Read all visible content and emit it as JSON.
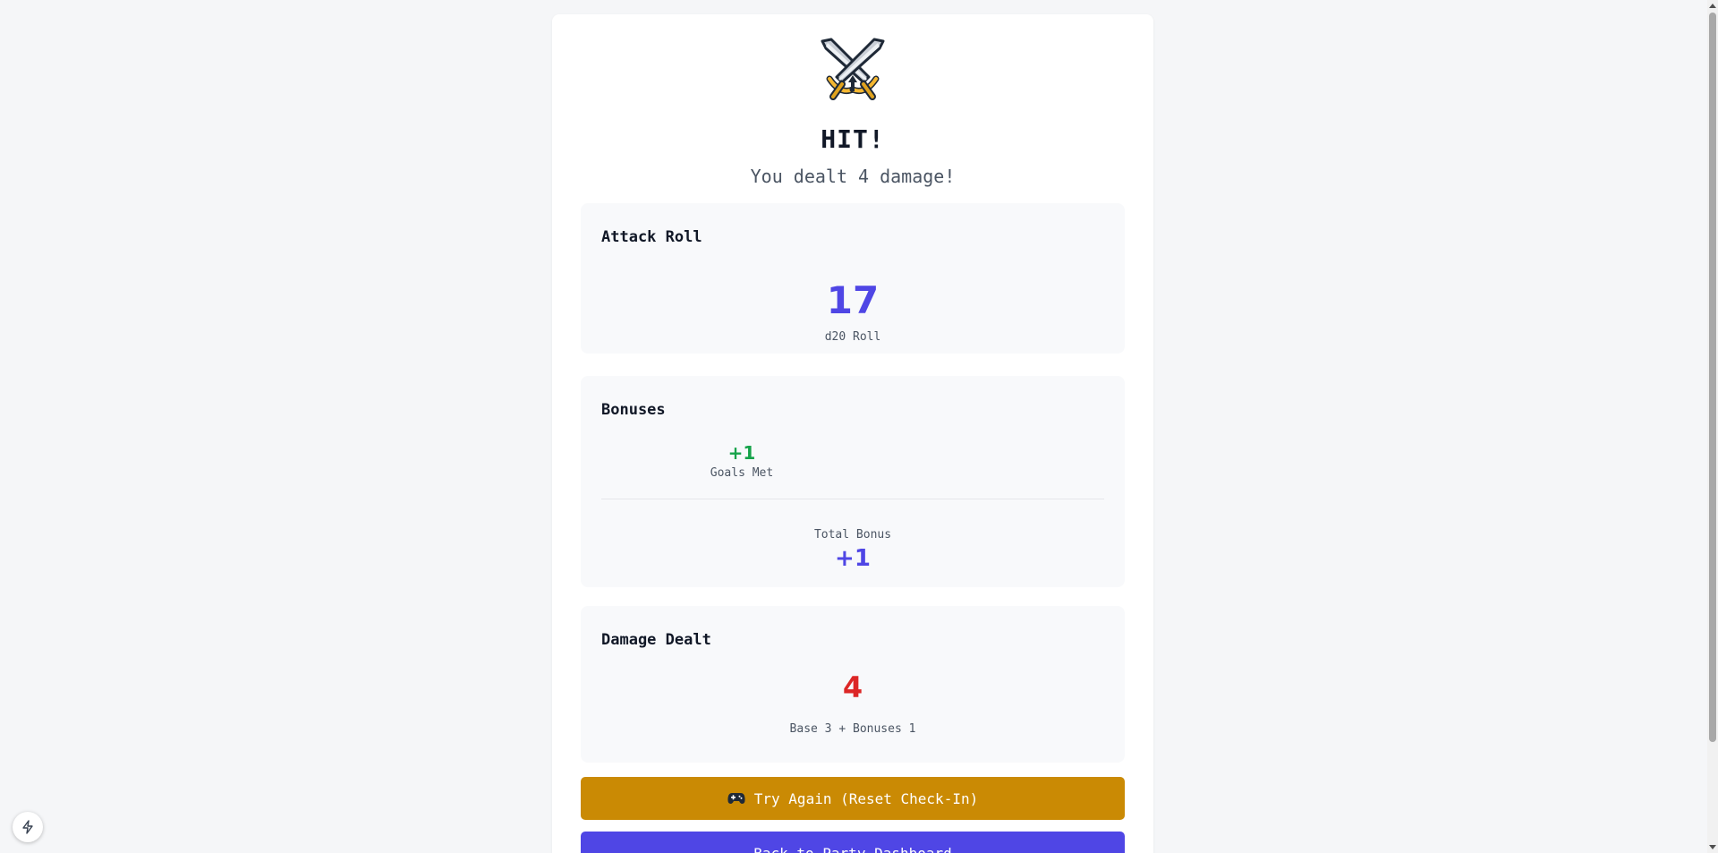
{
  "result": {
    "icon": "crossed-swords-icon",
    "title": "HIT!",
    "subtitle": "You dealt 4 damage!"
  },
  "attack_roll": {
    "title": "Attack Roll",
    "value": "17",
    "caption": "d20 Roll"
  },
  "bonuses": {
    "title": "Bonuses",
    "items": [
      {
        "value": "+1",
        "label": "Goals Met"
      }
    ],
    "total_label": "Total Bonus",
    "total_value": "+1"
  },
  "damage": {
    "title": "Damage Dealt",
    "value": "4",
    "caption": "Base 3 + Bonuses 1"
  },
  "actions": {
    "try_again_icon": "gamepad-icon",
    "try_again_label": "Try Again (Reset Check-In)",
    "back_label": "Back to Party Dashboard"
  },
  "colors": {
    "accent": "#4f46e5",
    "bonus_green": "#16a34a",
    "damage_red": "#dc2626",
    "try_again_gold": "#ca8a04"
  }
}
